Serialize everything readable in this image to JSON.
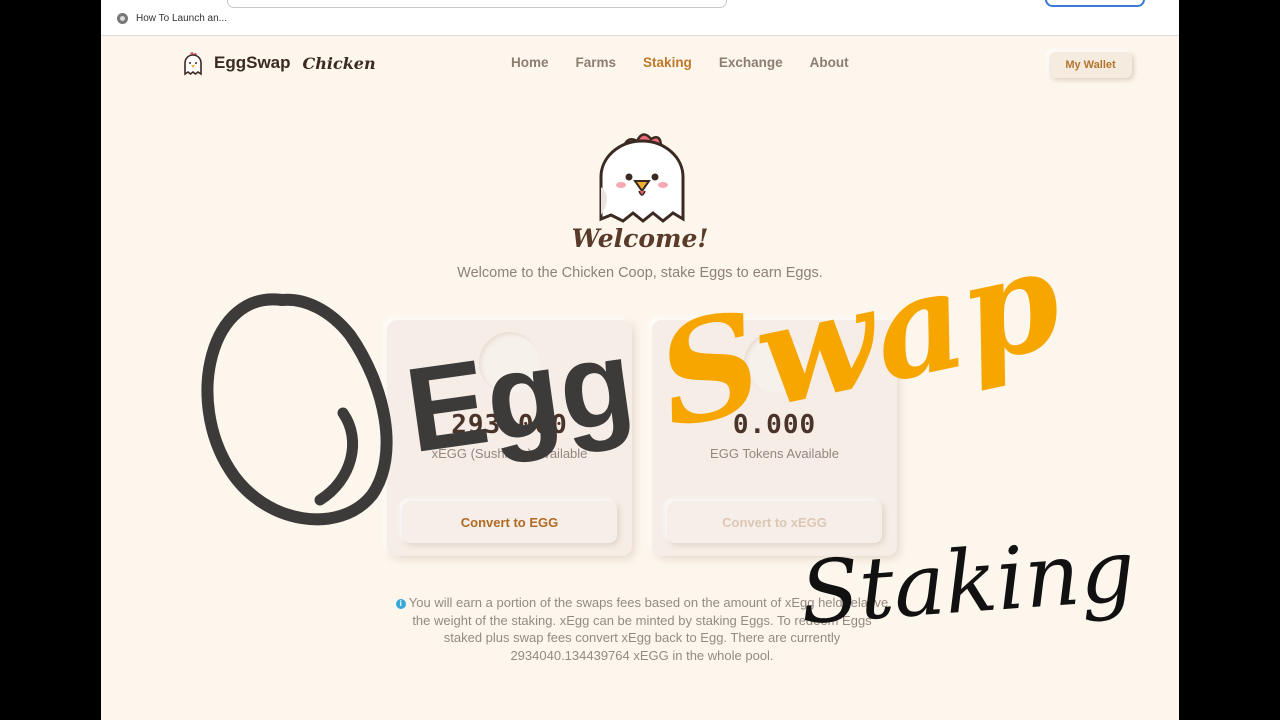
{
  "browser": {
    "bookmark_label": "How To Launch an..."
  },
  "brand": {
    "name": "EggSwap",
    "sub": "Chicken"
  },
  "nav": {
    "items": [
      {
        "label": "Home",
        "active": false
      },
      {
        "label": "Farms",
        "active": false
      },
      {
        "label": "Staking",
        "active": true
      },
      {
        "label": "Exchange",
        "active": false
      },
      {
        "label": "About",
        "active": false
      }
    ],
    "wallet_label": "My Wallet"
  },
  "hero": {
    "title": "Welcome!",
    "subtitle": "Welcome to the Chicken Coop, stake Eggs to earn Eggs."
  },
  "cards": {
    "xegg": {
      "amount": "293.000",
      "label": "xEGG (SushiBar) Available",
      "button": "Convert to EGG"
    },
    "egg": {
      "amount": "0.000",
      "label": "EGG Tokens Available",
      "button": "Convert to xEGG"
    }
  },
  "info": {
    "text": "You will earn a portion of the swaps fees based on the amount of xEgg held relative the weight of the staking. xEgg can be minted by staking Eggs. To redeem Eggs staked plus swap fees convert xEgg back to Egg. There are currently 2934040.134439764 xEGG in the whole pool."
  },
  "overlay": {
    "word_egg": "Egg",
    "word_swap": "Swap",
    "word_staking": "Staking",
    "color_egg": "#3d3a3a",
    "color_swap": "#f7a600",
    "color_staking": "#111111"
  },
  "colors": {
    "page_bg": "#fdf6ec",
    "accent": "#c0782a"
  }
}
